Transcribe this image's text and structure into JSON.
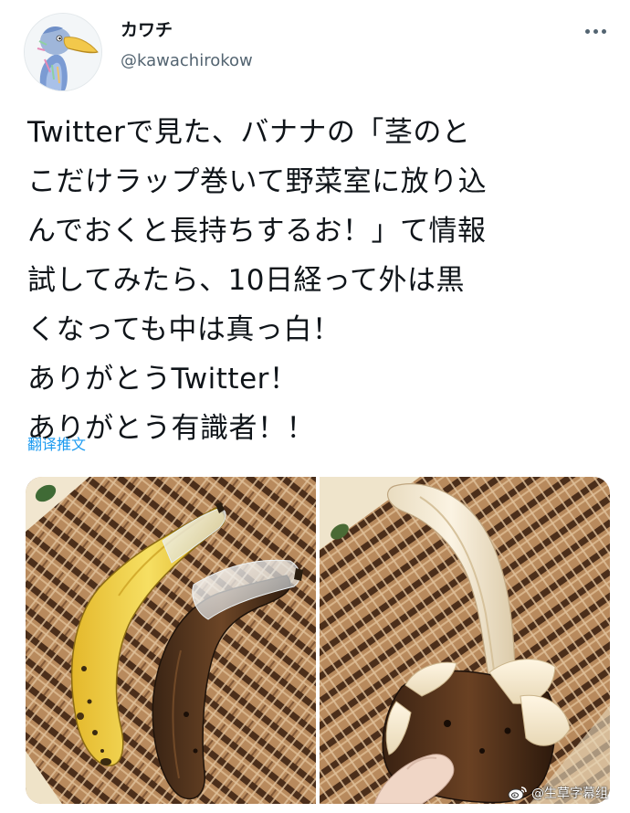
{
  "tweet": {
    "author": {
      "display_name": "カワチ",
      "handle": "@kawachirokow"
    },
    "text_lines": [
      "Twitterで見た、バナナの「茎のと",
      "こだけラップ巻いて野菜室に放り込",
      "んでおくと長持ちするお！」て情報",
      "試してみたら、10日経って外は黒",
      "くなっても中は真っ白！",
      "ありがとうTwitter！",
      "ありがとう有識者！！"
    ],
    "translate_label": "翻译推文",
    "more_icon": "more-horizontal-icon",
    "media": [
      {
        "description_icon": "photo-two-bananas-wrapped-stems"
      },
      {
        "description_icon": "photo-peeled-banana-white-inside"
      }
    ]
  },
  "watermark": {
    "text": "@生草字幕组",
    "icon": "weibo-logo-icon"
  },
  "colors": {
    "text_primary": "#0f1419",
    "text_secondary": "#536471",
    "link": "#1d9bf0",
    "mat_dark": "#5a3a22",
    "mat_light": "#c9a27a"
  }
}
